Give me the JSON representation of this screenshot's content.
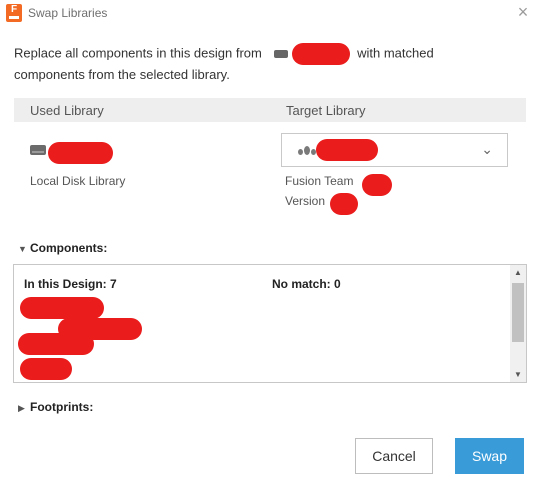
{
  "window": {
    "title": "Swap Libraries",
    "close_glyph": "×",
    "app_icon_letter": "F"
  },
  "description": {
    "before": "Replace all components in this design from",
    "after_line1": "with matched",
    "line2": "components from the selected library."
  },
  "libraries": {
    "used_header": "Used Library",
    "target_header": "Target Library",
    "used_type": "Local Disk Library",
    "target_team": "Fusion Team",
    "target_version": "Version",
    "dropdown_chevron": "⌄"
  },
  "components": {
    "label": "Components:",
    "expanded": true,
    "in_design": "In this Design: 7",
    "no_match": "No match: 0"
  },
  "footprints": {
    "label": "Footprints:",
    "expanded": false
  },
  "buttons": {
    "cancel": "Cancel",
    "swap": "Swap"
  },
  "colors": {
    "primary": "#3a9bd9",
    "app_icon": "#f26a24",
    "redaction": "#ea1c1c"
  }
}
